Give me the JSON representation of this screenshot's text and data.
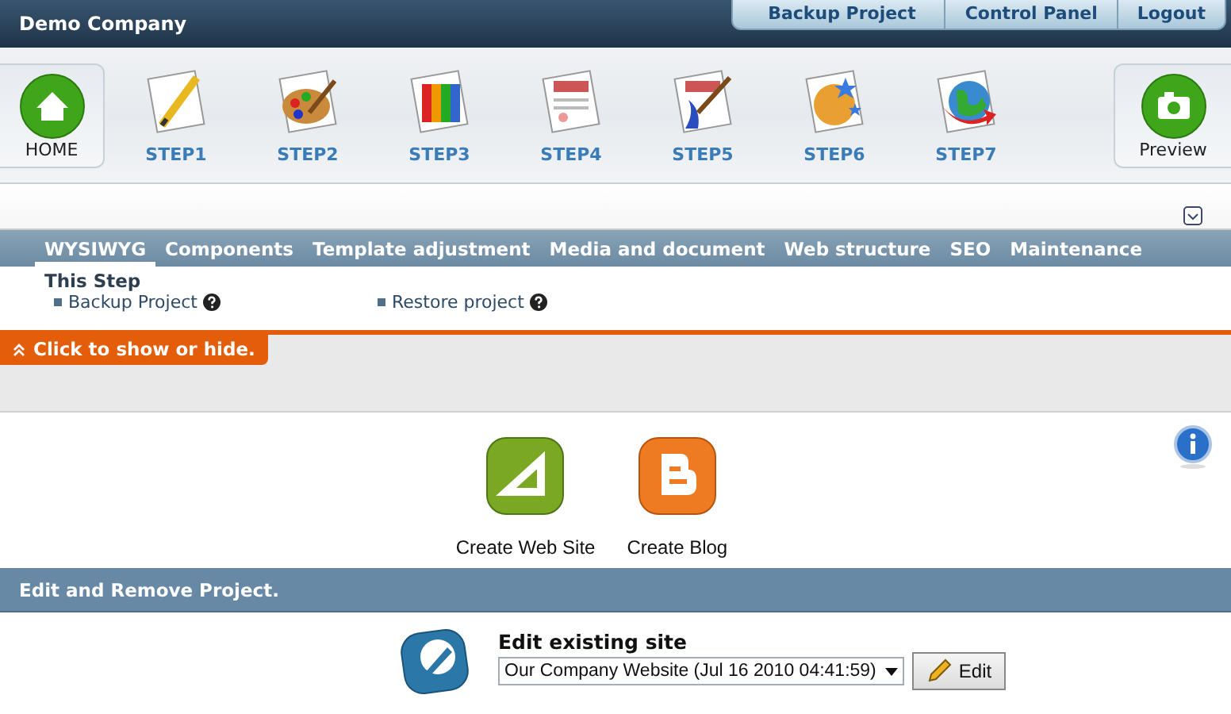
{
  "header": {
    "title": "Demo Company",
    "links": [
      "Backup Project",
      "Control Panel",
      "Logout"
    ]
  },
  "toolbar": {
    "home": "HOME",
    "preview": "Preview",
    "steps": [
      {
        "label": "STEP1",
        "kind": "pencil"
      },
      {
        "label": "STEP2",
        "kind": "palette"
      },
      {
        "label": "STEP3",
        "kind": "swatches"
      },
      {
        "label": "STEP4",
        "kind": "document"
      },
      {
        "label": "STEP5",
        "kind": "brush"
      },
      {
        "label": "STEP6",
        "kind": "stars"
      },
      {
        "label": "STEP7",
        "kind": "globe"
      }
    ]
  },
  "tabs": [
    {
      "label": "WYSIWYG",
      "selected": true
    },
    {
      "label": "Components",
      "selected": false
    },
    {
      "label": "Template adjustment",
      "selected": false
    },
    {
      "label": "Media and document",
      "selected": false
    },
    {
      "label": "Web structure",
      "selected": false
    },
    {
      "label": "SEO",
      "selected": false
    },
    {
      "label": "Maintenance",
      "selected": false
    }
  ],
  "this_step": {
    "title": "This Step",
    "links": [
      "Backup Project",
      "Restore project"
    ]
  },
  "toggle": "Click to show or hide.",
  "create": [
    {
      "label": "Create Web Site",
      "kind": "website"
    },
    {
      "label": "Create Blog",
      "kind": "blog"
    }
  ],
  "edit_section": {
    "title": "Edit and Remove Project.",
    "heading": "Edit existing site",
    "select_value": "Our Company Website (Jul 16 2010 04:41:59)",
    "button": "Edit"
  }
}
